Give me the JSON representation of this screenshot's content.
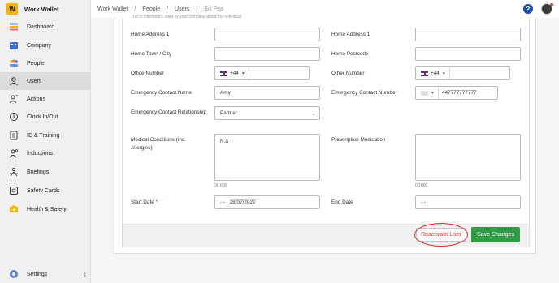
{
  "brand": {
    "logo_letter": "W",
    "name": "Work Wallet"
  },
  "sidebar": {
    "items": [
      {
        "label": "Dashboard",
        "icon": "dashboard-icon"
      },
      {
        "label": "Company",
        "icon": "company-icon"
      },
      {
        "label": "People",
        "icon": "people-icon"
      },
      {
        "label": "Users",
        "icon": "user-icon",
        "active": true
      },
      {
        "label": "Actions",
        "icon": "actions-icon"
      },
      {
        "label": "Clock In/Out",
        "icon": "clock-icon"
      },
      {
        "label": "ID & Training",
        "icon": "id-training-icon"
      },
      {
        "label": "Inductions",
        "icon": "inductions-icon"
      },
      {
        "label": "Briefings",
        "icon": "briefings-icon"
      },
      {
        "label": "Safety Cards",
        "icon": "safety-cards-icon"
      },
      {
        "label": "Health & Safety",
        "icon": "health-safety-icon"
      }
    ],
    "settings_label": "Settings",
    "collapse_glyph": "‹"
  },
  "breadcrumb": {
    "items": [
      "Work Wallet",
      "People",
      "Users",
      "Bill Pea"
    ],
    "separator": "/"
  },
  "header": {
    "help_glyph": "?"
  },
  "form": {
    "hint": "This is information filled by your company about the individual.",
    "home_address_1_label": "Home Address 1",
    "home_address_1_value": "",
    "home_address_1b_label": "Home Address 1",
    "home_address_1b_value": "",
    "home_town_label": "Home Town / City",
    "home_town_value": "",
    "home_postcode_label": "Home Postcode",
    "home_postcode_value": "",
    "office_number_label": "Office Number",
    "office_number_prefix": "+44",
    "office_number_value": "",
    "other_number_label": "Other Number",
    "other_number_prefix": "+44",
    "other_number_value": "",
    "emergency_name_label": "Emergency Contact Name",
    "emergency_name_value": "Amy",
    "emergency_number_label": "Emergency Contact Number",
    "emergency_number_value": "447777777777",
    "relationship_label": "Emergency Contact Relationship",
    "relationship_value": "Partner",
    "medical_label": "Medical Conditions (inc. Allergies)",
    "medical_value": "N.a",
    "medical_counter": "3/1000",
    "prescription_label": "Prescription Medication",
    "prescription_value": "",
    "prescription_counter": "0/1000",
    "start_date_label": "Start Date",
    "start_date_required": "*",
    "start_date_value": "28/07/2022",
    "end_date_label": "End Date",
    "end_date_value": ""
  },
  "actions": {
    "reactivate_label": "Reactivate User",
    "save_label": "Save Changes"
  },
  "colors": {
    "accent_save": "#2e9b45",
    "reactivate_text": "#d32f2f",
    "brand_yellow": "#f4b400",
    "help_blue": "#1f4fa0"
  }
}
